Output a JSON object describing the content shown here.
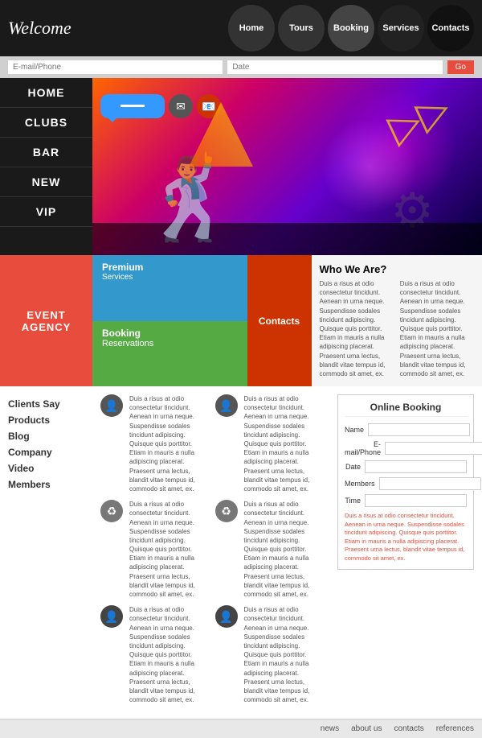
{
  "header": {
    "logo": "Welcome",
    "nav": [
      {
        "label": "Home",
        "class": "home"
      },
      {
        "label": "Tours",
        "class": "tours"
      },
      {
        "label": "Booking",
        "class": "booking"
      },
      {
        "label": "Services",
        "class": "services"
      },
      {
        "label": "Contacts",
        "class": "contacts"
      }
    ]
  },
  "searchbar": {
    "email_placeholder": "E-mail/Phone",
    "date_placeholder": "Date",
    "button_label": "Go"
  },
  "sidebar": {
    "items": [
      {
        "label": "HOME"
      },
      {
        "label": "CLUBS"
      },
      {
        "label": "BAR"
      },
      {
        "label": "NEW"
      },
      {
        "label": "VIP"
      }
    ]
  },
  "content": {
    "event_agency": "EVENT\nAGENCY",
    "premium": {
      "label": "Premium",
      "sublabel": "Services"
    },
    "booking_res": {
      "label": "Booking",
      "sublabel": "Reservations"
    },
    "contacts": "Contacts",
    "who_we_are": {
      "title": "Who We Are?",
      "text1": "Duis a risus at odio consectetur tincidunt. Aenean in urna neque. Suspendisse sodales tincidunt adipiscing. Quisque quis porttitor. Etiam in mauris a nulla adipiscing placerat. Praesent urna lectus, blandit vitae tempus id, commodo sit amet, ex.",
      "text2": "Duis a risus at odio consectetur tincidunt. Aenean in urna neque. Suspendisse sodales tincidunt adipiscing. Quisque quis porttitor. Etiam in mauris a nulla adipiscing placerat. Praesent urna lectus, blandit vitae tempus id, commodo sit amet, ex."
    }
  },
  "left_links": {
    "items": [
      {
        "label": "Clients Say"
      },
      {
        "label": "Products"
      },
      {
        "label": "Blog"
      },
      {
        "label": "Company"
      },
      {
        "label": "Video"
      },
      {
        "label": "Members"
      }
    ]
  },
  "testimonials": [
    {
      "icon": "👤",
      "icon_type": "person",
      "text": "Duis a risus at odio consectetur tincidunt. Aenean in urna neque. Suspendisse sodales tincidunt adipiscing. Quisque quis porttitor. Etiam in mauris a nulla adipiscing placerat. Praesent urna lectus, blandit vitae tempus id, commodo sit amet, ex."
    },
    {
      "icon": "♻",
      "icon_type": "recycle",
      "text": "Duis a risus at odio consectetur tincidunt. Aenean in urna neque. Suspendisse sodales tincidunt adipiscing. Quisque quis porttitor. Etiam in mauris a nulla adipiscing placerat. Praesent urna lectus, blandit vitae tempus id, commodo sit amet, ex."
    },
    {
      "icon": "👤",
      "icon_type": "person",
      "text": "Duis a risus at odio consectetur tincidunt. Aenean in urna neque. Suspendisse sodales tincidunt adipiscing. Quisque quis porttitor. Etiam in mauris a nulla adipiscing placerat. Praesent urna lectus, blandit vitae tempus id, commodo sit amet, ex."
    }
  ],
  "testimonials2": [
    {
      "icon": "👤",
      "text": "Duis a risus at odio consectetur tincidunt. Aenean in urna neque. Suspendisse sodales tincidunt adipiscing. Quisque quis porttitor. Etiam in mauris a nulla adipiscing placerat. Praesent urna lectus, blandit vitae tempus id, commodo sit amet, ex."
    },
    {
      "icon": "♻",
      "text": "Duis a risus at odio consectetur tincidunt. Aenean in urna neque. Suspendisse sodales tincidunt adipiscing. Quisque quis porttitor. Etiam in mauris a nulla adipiscing placerat. Praesent urna lectus, blandit vitae tempus id, commodo sit amet, ex."
    },
    {
      "icon": "👤",
      "text": "Duis a risus at odio consectetur tincidunt. Aenean in urna neque. Suspendisse sodales tincidunt adipiscing. Quisque quis porttitor. Etiam in mauris a nulla adipiscing placerat. Praesent urna lectus, blandit vitae tempus id, commodo sit amet, ex."
    }
  ],
  "online_booking": {
    "title": "Online Booking",
    "fields": [
      {
        "label": "Name",
        "placeholder": ""
      },
      {
        "label": "E-mail/Phone",
        "placeholder": ""
      },
      {
        "label": "Date",
        "placeholder": ""
      },
      {
        "label": "Members",
        "placeholder": ""
      },
      {
        "label": "Time",
        "placeholder": ""
      }
    ],
    "note": "Duis a risus at odio consectetur tincidunt. Aenean in urna neque. Suspendisse sodales tincidunt adipiscing. Quisque quis porttitor. Etiam in mauris a nulla adipiscing placerat. Praesent urna lectus, blandit vitae tempus id, commodo sit amet, ex."
  },
  "footer": {
    "links": [
      "news",
      "about us",
      "contacts",
      "references"
    ]
  }
}
